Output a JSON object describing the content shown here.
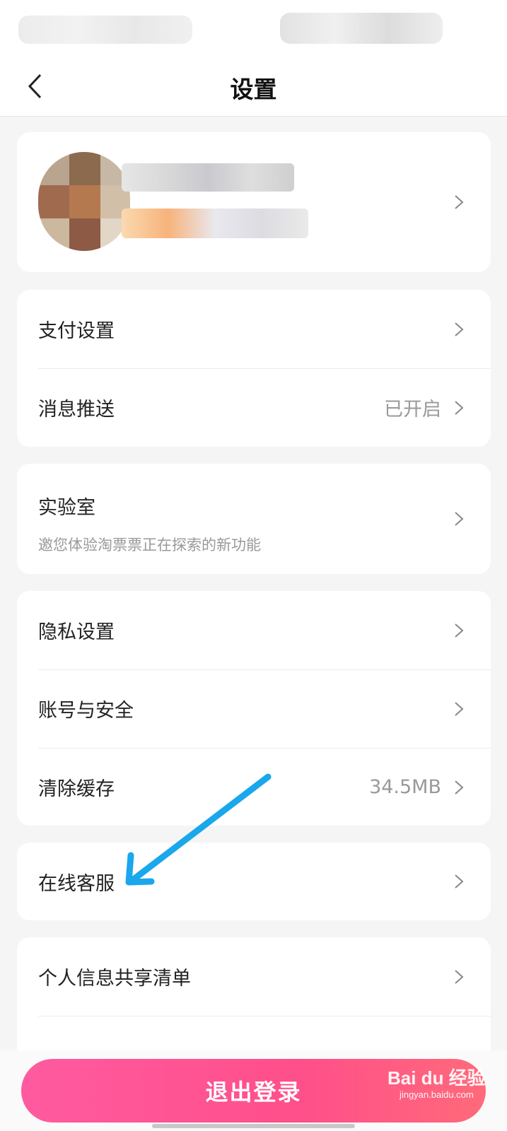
{
  "header": {
    "title": "设置"
  },
  "sections": [
    {
      "items": [
        {
          "label": "支付设置",
          "value": ""
        },
        {
          "label": "消息推送",
          "value": "已开启"
        }
      ]
    },
    {
      "lab": {
        "label": "实验室",
        "subtitle": "邀您体验淘票票正在探索的新功能"
      }
    },
    {
      "items": [
        {
          "label": "隐私设置",
          "value": ""
        },
        {
          "label": "账号与安全",
          "value": ""
        },
        {
          "label": "清除缓存",
          "value": "34.5MB"
        }
      ]
    },
    {
      "items": [
        {
          "label": "在线客服",
          "value": ""
        }
      ]
    },
    {
      "items": [
        {
          "label": "个人信息共享清单",
          "value": ""
        }
      ]
    }
  ],
  "logout_label": "退出登录",
  "watermark": {
    "brand": "Bai du 经验",
    "url": "jingyan.baidu.com"
  },
  "colors": {
    "accent": "#ff4f8a",
    "arrow": "#1aa7ec",
    "background": "#f5f5f5"
  }
}
